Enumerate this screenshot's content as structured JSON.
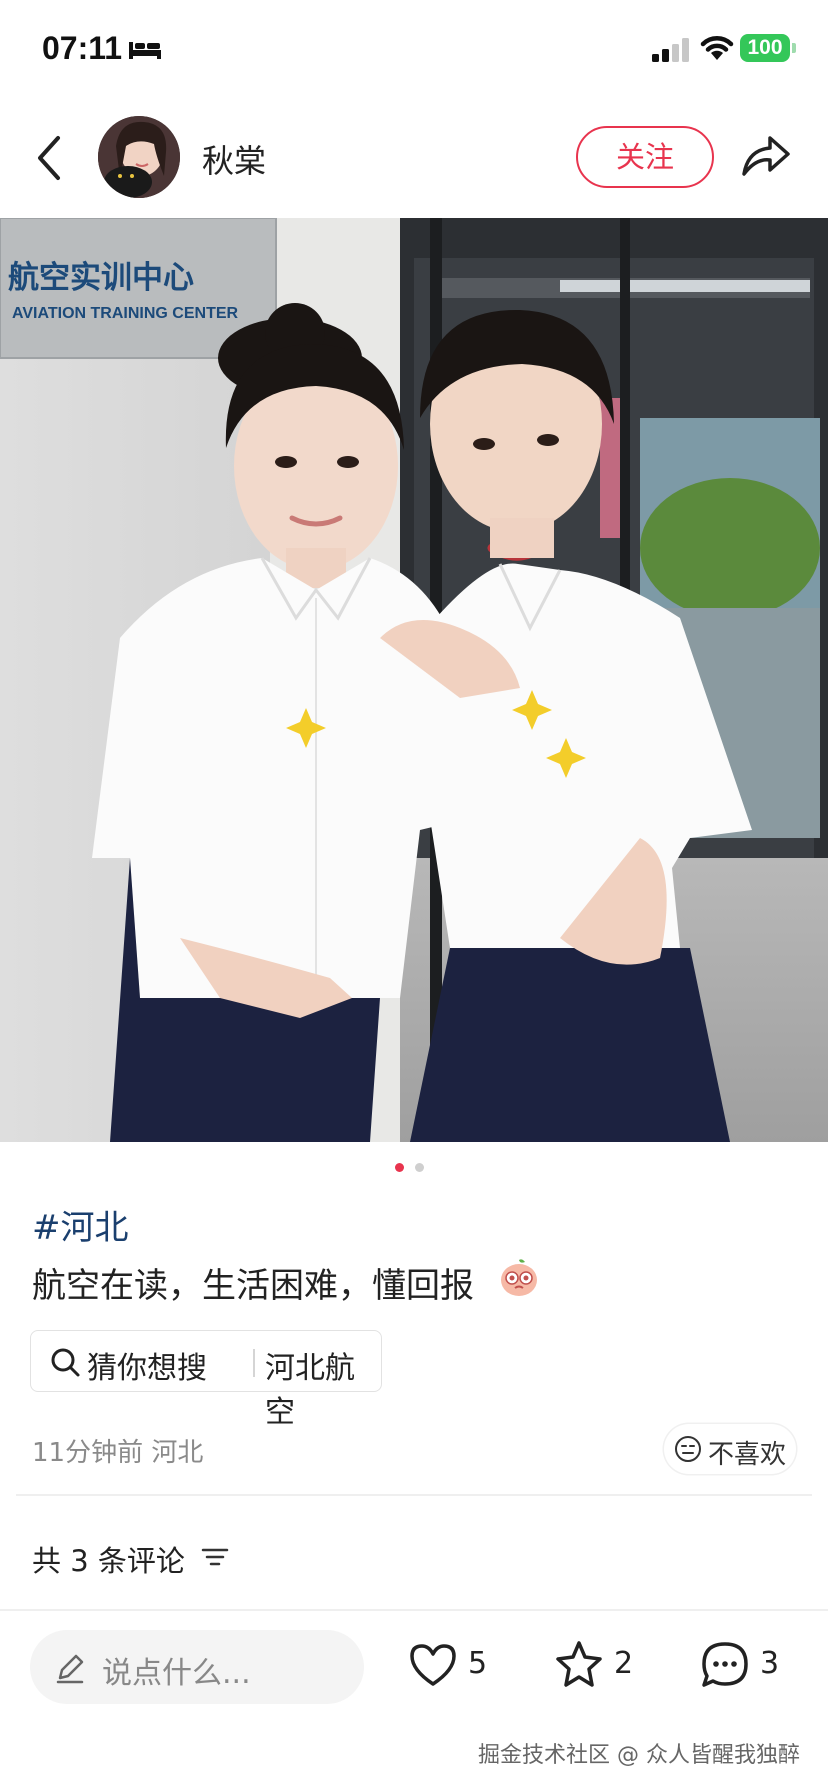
{
  "status_bar": {
    "time": "07:11",
    "battery": "100",
    "colors": {
      "battery": "#34c759"
    }
  },
  "header": {
    "username": "秋棠",
    "follow_label": "关注",
    "accent": "#e8344e"
  },
  "photo": {
    "sign_cn": "航空实训中心",
    "sign_en": "AVIATION TRAINING CENTER",
    "page_count": 2,
    "active_page": 1
  },
  "post": {
    "hashtag": "#河北",
    "text": "航空在读，生活困难，懂回报",
    "search_chip": {
      "label": "猜你想搜",
      "query": "河北航空"
    },
    "meta": "11分钟前  河北",
    "dislike_label": "不喜欢"
  },
  "comments": {
    "count_label": "共 3 条评论"
  },
  "bottom_bar": {
    "input_placeholder": "说点什么...",
    "likes": "5",
    "favorites": "2",
    "comments": "3"
  },
  "watermark": "掘金技术社区 @ 众人皆醒我独醉"
}
